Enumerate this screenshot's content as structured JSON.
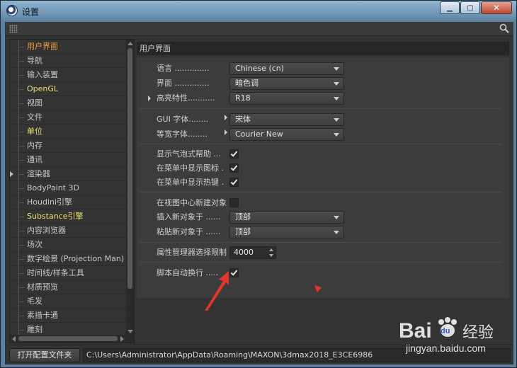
{
  "window": {
    "title": "设置"
  },
  "sidebar": {
    "items": [
      {
        "label": "用户界面",
        "state": "active"
      },
      {
        "label": "导航",
        "state": ""
      },
      {
        "label": "输入装置",
        "state": ""
      },
      {
        "label": "OpenGL",
        "state": "hl"
      },
      {
        "label": "视图",
        "state": ""
      },
      {
        "label": "文件",
        "state": ""
      },
      {
        "label": "单位",
        "state": "hl"
      },
      {
        "label": "内存",
        "state": ""
      },
      {
        "label": "通讯",
        "state": ""
      },
      {
        "label": "渲染器",
        "state": "",
        "expander": true
      },
      {
        "label": "BodyPaint 3D",
        "state": ""
      },
      {
        "label": "Houdini引擎",
        "state": ""
      },
      {
        "label": "Substance引擎",
        "state": "hl"
      },
      {
        "label": "内容浏览器",
        "state": ""
      },
      {
        "label": "场次",
        "state": ""
      },
      {
        "label": "数字绘景 (Projection Man)",
        "state": ""
      },
      {
        "label": "时间线/样条工具",
        "state": ""
      },
      {
        "label": "材质预览",
        "state": ""
      },
      {
        "label": "毛发",
        "state": ""
      },
      {
        "label": "素描卡通",
        "state": ""
      },
      {
        "label": "雕刻",
        "state": ""
      }
    ]
  },
  "main": {
    "header": "用户界面",
    "language": {
      "label": "语言 ..............",
      "value": "Chinese (cn)"
    },
    "interface": {
      "label": "界面 ..............",
      "value": "暗色调"
    },
    "highlight": {
      "label": "高亮特性...........",
      "value": "R18"
    },
    "gui_font": {
      "label": "GUI 字体........",
      "value": "宋体"
    },
    "mono_font": {
      "label": "等宽字体........",
      "value": "Courier New"
    },
    "bubble_help": {
      "label": "显示气泡式帮助 ...",
      "checked": true
    },
    "menu_icons": {
      "label": "在菜单中显示图标 .",
      "checked": true
    },
    "menu_hotkeys": {
      "label": "在菜单中显示热键 .",
      "checked": true
    },
    "new_at_center": {
      "label": "在视图中心新建对象",
      "checked": false
    },
    "insert_at": {
      "label": "插入新对象于 ......",
      "value": "顶部"
    },
    "paste_at": {
      "label": "粘贴新对象于 ......",
      "value": "顶部"
    },
    "attr_limit": {
      "label": "属性管理器选择限制",
      "value": "4000"
    },
    "script_wrap": {
      "label": "脚本自动换行 .....",
      "checked": true
    }
  },
  "footer": {
    "open_button": "打开配置文件夹",
    "path": "C:\\Users\\Administrator\\AppData\\Roaming\\MAXON\\3dmax2018_E3CE6986"
  },
  "watermark": {
    "brand": "Bai",
    "paw": "du",
    "site_cn": "经验",
    "url": "jingyan.baidu.com"
  },
  "colors": {
    "active": "#f0a040",
    "highlight": "#e8e070",
    "annotation": "#e8332a"
  }
}
